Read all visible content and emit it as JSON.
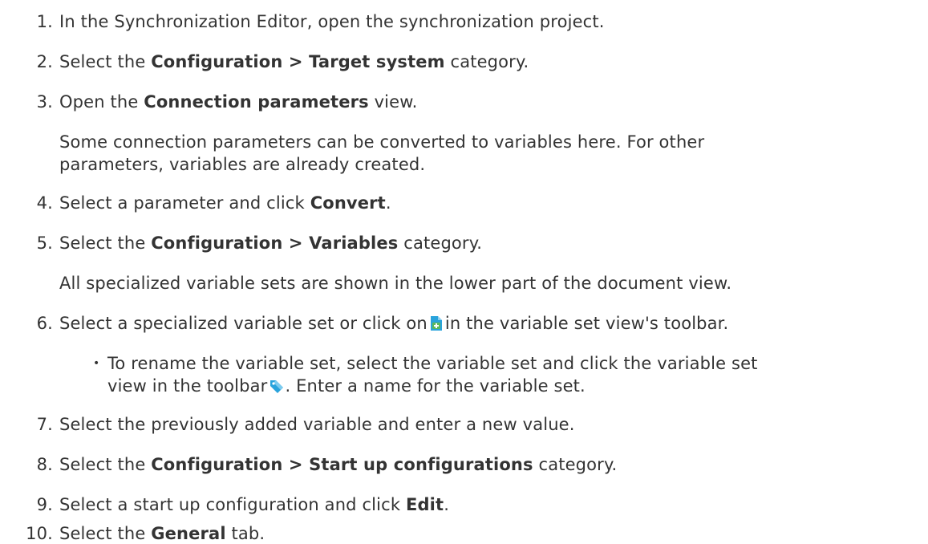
{
  "steps": [
    {
      "num": "1.",
      "text": "In the Synchronization Editor, open the synchronization project."
    },
    {
      "num": "2.",
      "pre": "Select the ",
      "bold": "Configuration > Target system",
      "post": " category."
    },
    {
      "num": "3.",
      "pre": "Open the ",
      "bold": "Connection parameters",
      "post": " view.",
      "note_line1": "Some connection parameters can be converted to variables here. For other",
      "note_line2": "parameters, variables are already created."
    },
    {
      "num": "4.",
      "pre": "Select a parameter and click ",
      "bold": "Convert",
      "post": "."
    },
    {
      "num": "5.",
      "pre": "Select the ",
      "bold": "Configuration > Variables",
      "post": " category.",
      "note_line1": "All specialized variable sets are shown in the lower part of the document view."
    },
    {
      "num": "6.",
      "pre": "Select a specialized variable set or click on",
      "post": "in the variable set view's toolbar.",
      "icon": "add-variable-set-icon",
      "sub_line1": "To rename the variable set, select the variable set and click the variable set",
      "sub_line2_pre": "view in the toolbar",
      "sub_line2_post": ". Enter a name for the variable set.",
      "sub_icon": "rename-tag-icon",
      "bullet": "•"
    },
    {
      "num": "7.",
      "text": "Select the previously added variable and enter a new value."
    },
    {
      "num": "8.",
      "pre": "Select the ",
      "bold": "Configuration > Start up configurations",
      "post": " category."
    },
    {
      "num": "9.",
      "pre": "Select a start up configuration and click ",
      "bold": "Edit",
      "post": "."
    },
    {
      "num": "10.",
      "pre": "Select the ",
      "bold": "General",
      "post": " tab."
    }
  ],
  "colors": {
    "text": "#333333",
    "icon_blue": "#29a3dc",
    "icon_green": "#5cb85c"
  }
}
